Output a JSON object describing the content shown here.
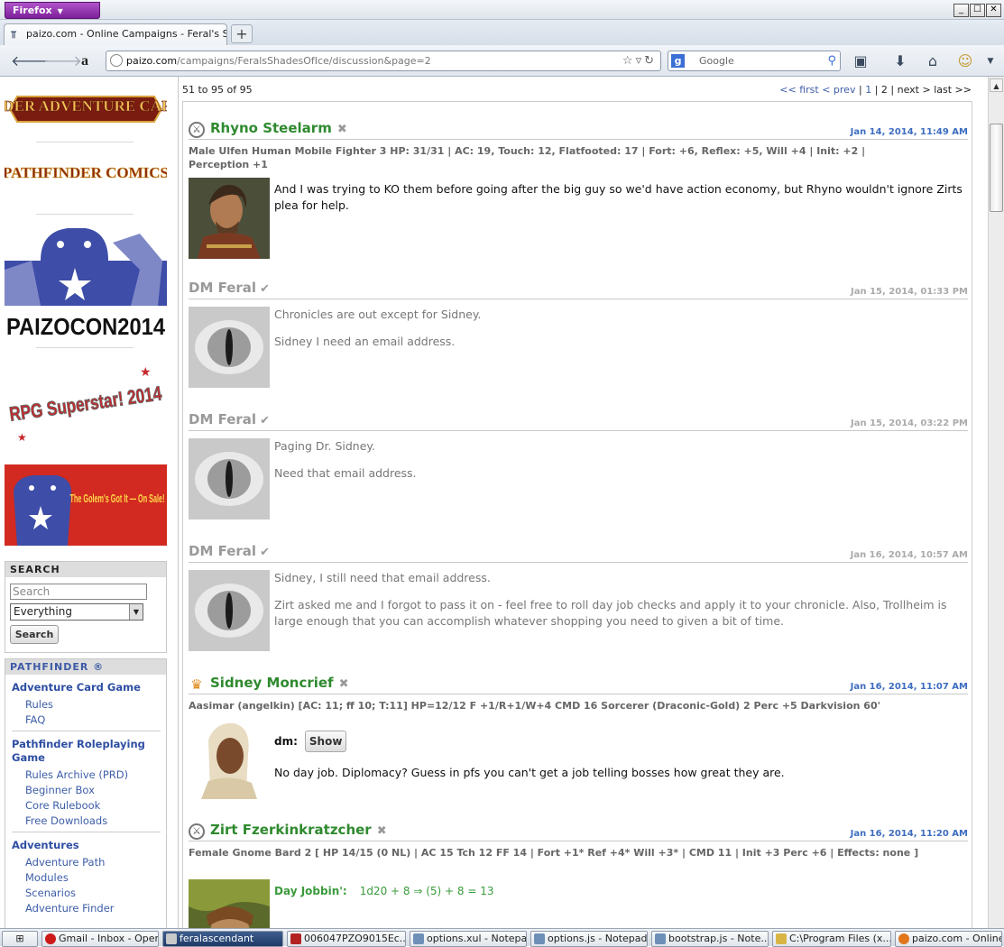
{
  "browser": {
    "app_menu_label": "Firefox",
    "tab_title": "paizo.com - Online Campaigns - Feral's Shad...",
    "new_tab_label": "+",
    "url_domain": "paizo.com",
    "url_path": "/campaigns/FeralsShadesOfIce/discussion&page=2",
    "search_engine": "Google",
    "search_placeholder": "Google",
    "window_controls": [
      "_",
      "☐",
      "✕"
    ]
  },
  "sidebar": {
    "banners": [
      "PATHFINDER ADVENTURE CARD GAME",
      "PATHFINDER COMICS",
      "PAIZOCON2014",
      "RPG Superstar! 2014",
      "The Golem's Got It — On Sale!"
    ],
    "search": {
      "heading": "SEARCH",
      "placeholder": "Search",
      "scope": "Everything",
      "button": "Search"
    },
    "pathfinder": {
      "heading": "PATHFINDER ®",
      "sections": [
        {
          "title": "Adventure Card Game",
          "links": [
            "Rules",
            "FAQ"
          ]
        },
        {
          "title": "Pathfinder Roleplaying Game",
          "links": [
            "Rules Archive (PRD)",
            "Beginner Box",
            "Core Rulebook",
            "Free Downloads"
          ]
        },
        {
          "title": "Adventures",
          "links": [
            "Adventure Path",
            "Modules",
            "Scenarios",
            "Adventure Finder"
          ]
        }
      ]
    }
  },
  "pager": {
    "range": "51 to 95 of 95",
    "first": "<< first",
    "prev": "< prev",
    "sep1": "|",
    "page1": "1",
    "sep2": "|",
    "page2": "2",
    "sep3": "|",
    "next": "next >",
    "last": "last >>"
  },
  "posts": [
    {
      "author": "Rhyno Steelarm",
      "date": "Jan 14, 2014, 11:49 AM",
      "stats": "Male Ulfen Human Mobile Fighter 3 HP: 31/31 | AC: 19, Touch: 12, Flatfooted: 17 | Fort: +6, Reflex: +5, Will +4 | Init: +2 | Perception +1",
      "body": [
        "And I was trying to KO them before going after the big guy so we'd have action economy, but Rhyno wouldn't ignore Zirts plea for help."
      ]
    },
    {
      "author": "DM Feral",
      "date": "Jan 15, 2014, 01:33 PM",
      "body": [
        "Chronicles are out except for Sidney.",
        "Sidney I need an email address."
      ]
    },
    {
      "author": "DM Feral",
      "date": "Jan 15, 2014, 03:22 PM",
      "body": [
        "Paging Dr. Sidney.",
        "Need that email address."
      ]
    },
    {
      "author": "DM Feral",
      "date": "Jan 16, 2014, 10:57 AM",
      "body": [
        "Sidney, I still need that email address.",
        "Zirt asked me and I forgot to pass it on - feel free to roll day job checks and apply it to your chronicle. Also, Trollheim is large enough that you can accomplish whatever shopping you need to given a bit of time."
      ]
    },
    {
      "author": "Sidney Moncrief",
      "date": "Jan 16, 2014, 11:07 AM",
      "stats": "Aasimar (angelkin) [AC: 11; ff 10; T:11] HP=12/12 F +1/R+1/W+4 CMD 16 Sorcerer (Draconic-Gold) 2 Perc +5 Darkvision 60'",
      "dm_label": "dm:",
      "show_button": "Show",
      "body": [
        "No day job. Diplomacy? Guess in pfs you can't get a job telling bosses how great they are."
      ]
    },
    {
      "author": "Zirt Fzerkinkratzcher",
      "date": "Jan 16, 2014, 11:20 AM",
      "stats": "Female Gnome Bard 2 [ HP 14/15 (0 NL) | AC 15 Tch 12 FF 14 | Fort +1* Ref +4* Will +3* | CMD 11 | Init +3 Perc +6 | Effects: none ]",
      "roll_label": "Day Jobbin':",
      "roll": "1d20 + 8 ⇒ (5) + 8 = 13"
    }
  ],
  "taskbar": [
    {
      "label": "Gmail - Inbox - Opera",
      "color": "#cc1a1a"
    },
    {
      "label": "feralascendant",
      "color": "#2a3b55"
    },
    {
      "label": "006047PZO9015Ec...",
      "color": "#b22222"
    },
    {
      "label": "options.xul - Notepad",
      "color": "#6d8fb8"
    },
    {
      "label": "options.js - Notepad",
      "color": "#6d8fb8"
    },
    {
      "label": "bootstrap.js - Note...",
      "color": "#6d8fb8"
    },
    {
      "label": "C:\\Program Files (x...",
      "color": "#d9b545"
    },
    {
      "label": "paizo.com - Online ...",
      "color": "#e2761b"
    }
  ]
}
